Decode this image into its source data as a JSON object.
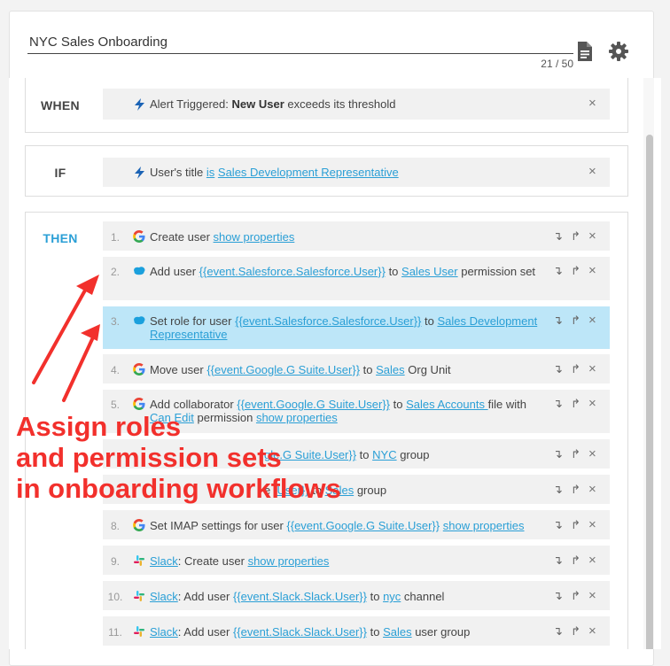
{
  "workflow": {
    "title": "NYC Sales Onboarding",
    "counter": "21 / 50"
  },
  "header_icons": [
    "document-icon",
    "gear-icon"
  ],
  "sections": {
    "when": {
      "label": "WHEN",
      "parts": [
        {
          "t": "Alert Triggered: ",
          "s": "plain"
        },
        {
          "t": "New User",
          "s": "bold"
        },
        {
          "t": " exceeds its threshold",
          "s": "plain"
        }
      ]
    },
    "if": {
      "label": "IF",
      "parts": [
        {
          "t": "User's title ",
          "s": "plain"
        },
        {
          "t": "is",
          "s": "link"
        },
        {
          "t": " ",
          "s": "plain"
        },
        {
          "t": "Sales Development Representative",
          "s": "link"
        }
      ]
    },
    "then": {
      "label": "THEN"
    }
  },
  "steps": [
    {
      "num": "1.",
      "icon": "google",
      "parts": [
        {
          "t": "Create user ",
          "s": "plain"
        },
        {
          "t": "show properties",
          "s": "link"
        }
      ]
    },
    {
      "num": "2.",
      "icon": "salesforce",
      "parts": [
        {
          "t": "Add user ",
          "s": "plain"
        },
        {
          "t": "{{event.Salesforce.Salesforce.User}}",
          "s": "link"
        },
        {
          "t": " to ",
          "s": "plain"
        },
        {
          "t": "Sales User",
          "s": "link"
        },
        {
          "t": " permission set",
          "s": "plain"
        }
      ]
    },
    {
      "num": "3.",
      "icon": "salesforce",
      "parts": [
        {
          "t": "Set role for user ",
          "s": "plain"
        },
        {
          "t": "{{event.Salesforce.Salesforce.User}}",
          "s": "link"
        },
        {
          "t": " to ",
          "s": "plain"
        },
        {
          "t": "Sales Development Representative",
          "s": "link"
        }
      ]
    },
    {
      "num": "4.",
      "icon": "google",
      "parts": [
        {
          "t": "Move user ",
          "s": "plain"
        },
        {
          "t": "{{event.Google.G Suite.User}}",
          "s": "link"
        },
        {
          "t": " to ",
          "s": "plain"
        },
        {
          "t": "Sales",
          "s": "link"
        },
        {
          "t": " Org Unit",
          "s": "plain"
        }
      ]
    },
    {
      "num": "5.",
      "icon": "google",
      "parts": [
        {
          "t": "Add collaborator ",
          "s": "plain"
        },
        {
          "t": "{{event.Google.G Suite.User}}",
          "s": "link"
        },
        {
          "t": " to ",
          "s": "plain"
        },
        {
          "t": "Sales Accounts ",
          "s": "link"
        },
        {
          "t": "file with ",
          "s": "plain"
        },
        {
          "t": "Can Edit",
          "s": "link"
        },
        {
          "t": " permission ",
          "s": "plain"
        },
        {
          "t": "show properties",
          "s": "link"
        }
      ]
    },
    {
      "num": "",
      "icon": "",
      "parts": [
        {
          "t": "gle.G Suite.User}}",
          "s": "link"
        },
        {
          "t": " to ",
          "s": "plain"
        },
        {
          "t": "NYC",
          "s": "link"
        },
        {
          "t": " group",
          "s": "plain"
        }
      ]
    },
    {
      "num": "",
      "icon": "",
      "parts": [
        {
          "t": "e ",
          "s": "plain"
        },
        {
          "t": ".User}}",
          "s": "link"
        },
        {
          "t": " to ",
          "s": "plain"
        },
        {
          "t": "Sales",
          "s": "link"
        },
        {
          "t": " group",
          "s": "plain"
        }
      ]
    },
    {
      "num": "8.",
      "icon": "google",
      "parts": [
        {
          "t": "Set IMAP settings for user ",
          "s": "plain"
        },
        {
          "t": "{{event.Google.G Suite.User}}",
          "s": "link"
        },
        {
          "t": " ",
          "s": "plain"
        },
        {
          "t": "show properties",
          "s": "link"
        }
      ]
    },
    {
      "num": "9.",
      "icon": "slack",
      "parts": [
        {
          "t": "Slack",
          "s": "link"
        },
        {
          "t": ": Create user ",
          "s": "plain"
        },
        {
          "t": "show properties",
          "s": "link"
        }
      ]
    },
    {
      "num": "10.",
      "icon": "slack",
      "parts": [
        {
          "t": "Slack",
          "s": "link"
        },
        {
          "t": ": Add user ",
          "s": "plain"
        },
        {
          "t": "{{event.Slack.Slack.User}}",
          "s": "link"
        },
        {
          "t": " to ",
          "s": "plain"
        },
        {
          "t": "nyc",
          "s": "link"
        },
        {
          "t": " channel",
          "s": "plain"
        }
      ]
    },
    {
      "num": "11.",
      "icon": "slack",
      "parts": [
        {
          "t": "Slack",
          "s": "link"
        },
        {
          "t": ": Add user ",
          "s": "plain"
        },
        {
          "t": "{{event.Slack.Slack.User}}",
          "s": "link"
        },
        {
          "t": " to ",
          "s": "plain"
        },
        {
          "t": "Sales",
          "s": "link"
        },
        {
          "t": " user group",
          "s": "plain"
        }
      ]
    }
  ],
  "step_controls": {
    "move_down": "↴",
    "move_up": "↱",
    "remove": "×"
  },
  "annotation": {
    "lines": [
      "Assign roles",
      "and permission sets",
      "in onboarding workflows"
    ],
    "color": "#f2302c"
  },
  "colors": {
    "link": "#2a9fd6",
    "highlight": "#bde6f8",
    "row": "#f1f1f1"
  }
}
